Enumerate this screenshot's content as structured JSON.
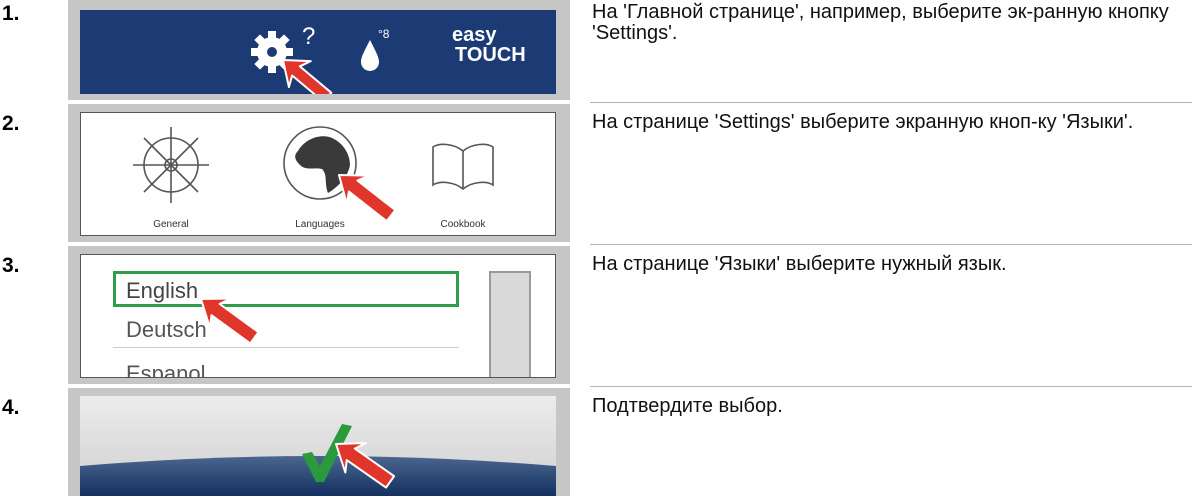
{
  "steps": [
    {
      "number": "1.",
      "text": "На 'Главной странице', например, выберите эк-ранную кнопку 'Settings'.",
      "screen": {
        "brand_top": "easy",
        "brand_bottom": "TOUCH",
        "icons": [
          "gear-icon",
          "help-question-icon",
          "water-drop-icon"
        ]
      }
    },
    {
      "number": "2.",
      "text": "На странице 'Settings' выберите экранную кноп-ку 'Языки'.",
      "screen": {
        "items": [
          {
            "label": "General",
            "icon": "ship-wheel-icon"
          },
          {
            "label": "Languages",
            "icon": "globe-icon"
          },
          {
            "label": "Cookbook",
            "icon": "book-icon"
          }
        ]
      }
    },
    {
      "number": "3.",
      "text": "На странице 'Языки' выберите нужный язык.",
      "screen": {
        "languages": [
          "English",
          "Deutsch",
          "Espanol"
        ],
        "selected": "English"
      }
    },
    {
      "number": "4.",
      "text": "Подтвердите выбор.",
      "screen": {
        "icon": "check-icon"
      }
    }
  ],
  "colors": {
    "banner_blue": "#1c3b74",
    "arrow_red": "#e0352b",
    "selection_green": "#2f9e4c",
    "check_green": "#2a9a3c",
    "frame_gray": "#c6c6c6"
  }
}
